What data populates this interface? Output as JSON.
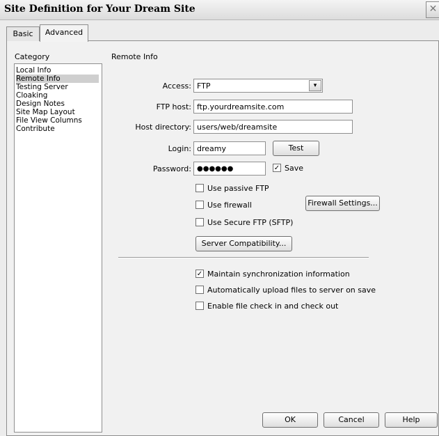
{
  "window": {
    "title": "Site Definition for Your Dream Site",
    "close_glyph": "✕"
  },
  "tabs": [
    {
      "label": "Basic"
    },
    {
      "label": "Advanced"
    }
  ],
  "category": {
    "header": "Category",
    "items": [
      "Local Info",
      "Remote Info",
      "Testing Server",
      "Cloaking",
      "Design Notes",
      "Site Map Layout",
      "File View Columns",
      "Contribute"
    ],
    "selected": "Remote Info"
  },
  "remote": {
    "section_title": "Remote Info",
    "access_label": "Access:",
    "access_value": "FTP",
    "ftp_host_label": "FTP host:",
    "ftp_host_value": "ftp.yourdreamsite.com",
    "host_dir_label": "Host directory:",
    "host_dir_value": "users/web/dreamsite",
    "login_label": "Login:",
    "login_value": "dreamy",
    "test_label": "Test",
    "password_label": "Password:",
    "password_value": "●●●●●●",
    "save_label": "Save",
    "save_checked": true,
    "passive_ftp_label": "Use passive FTP",
    "firewall_label": "Use firewall",
    "firewall_settings_label": "Firewall Settings...",
    "sftp_label": "Use Secure FTP (SFTP)",
    "server_compat_label": "Server Compatibility...",
    "maintain_sync_label": "Maintain synchronization information",
    "maintain_sync_checked": true,
    "auto_upload_label": "Automatically upload files to server on save",
    "checkin_label": "Enable file check in and check out"
  },
  "footer": {
    "ok_label": "OK",
    "cancel_label": "Cancel",
    "help_label": "Help"
  },
  "colors": {
    "selected_item": "#cfcfcf",
    "panel": "#f1f1f1",
    "background": "#ececec"
  },
  "icons": {
    "checkbox_check": "✓",
    "dropdown": "▾"
  }
}
